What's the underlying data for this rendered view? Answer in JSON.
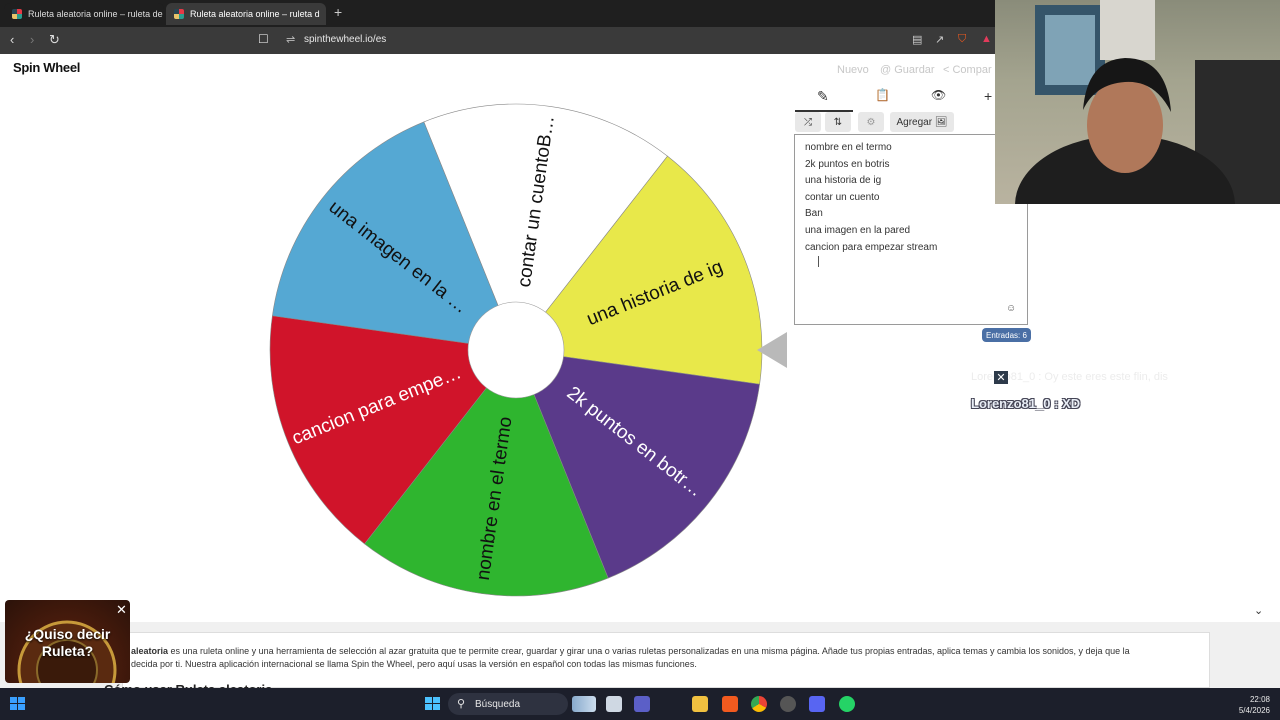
{
  "browser": {
    "tabs": [
      {
        "label": "Ruleta aleatoria online – ruleta de la s"
      },
      {
        "label": "Ruleta aleatoria online – ruleta d"
      }
    ],
    "new_tab": "+",
    "url": "spinthewheel.io/es"
  },
  "header": {
    "logo": "Spin Wheel",
    "actions": {
      "new": "Nuevo",
      "save": "Guardar",
      "share": "Compar"
    }
  },
  "wheel": {
    "segments": [
      {
        "label": "contar un cuentoB…",
        "color": "#ffffff"
      },
      {
        "label": "una historia de ig",
        "color": "#e8e84a"
      },
      {
        "label": "2k puntos en botr…",
        "color": "#5a3a8a"
      },
      {
        "label": "nombre en el termo",
        "color": "#2fb52f"
      },
      {
        "label": "cancion para empe…",
        "color": "#d0142a"
      },
      {
        "label": "una imagen en la …",
        "color": "#55a8d3"
      }
    ],
    "pointer_color": "#b9b9b9"
  },
  "editor": {
    "tabs": {
      "edit": "✎",
      "clipboard": "📋",
      "hide": "👁",
      "add": "+"
    },
    "tools": {
      "shuffle": "⤮",
      "sort": "⇅",
      "settings": "⚙",
      "add_image": "Agregar 🖼"
    },
    "entries": [
      "nombre en el termo",
      "2k puntos en botris",
      "una historia de ig",
      "contar un cuento",
      "Ban",
      "una imagen en la pared",
      "cancion para empezar stream"
    ],
    "count_label": "Entradas: 6"
  },
  "chat": {
    "faded": "Lorenzo81_0 : Oy este eres este flin, dis",
    "message": "Lorenzo81_0 : XD"
  },
  "ad": {
    "text": "¿Quiso decir Ruleta?",
    "close": "✕"
  },
  "description": {
    "bold": "aleatoria",
    "text": " es una ruleta online y una herramienta de selección al azar gratuita que te permite crear, guardar y girar una o varias ruletas personalizadas en una misma página. Añade tus propias entradas, aplica temas y cambia los sonidos, y deja que la",
    "text2": "decida por ti. Nuestra aplicación internacional se llama Spin the Wheel, pero aquí usas la versión en español con todas las mismas funciones.",
    "howto": "Cómo usar Ruleta aleatoria"
  },
  "taskbar": {
    "search": "Búsqueda",
    "time": "22:08",
    "date": "5/4/2026"
  }
}
